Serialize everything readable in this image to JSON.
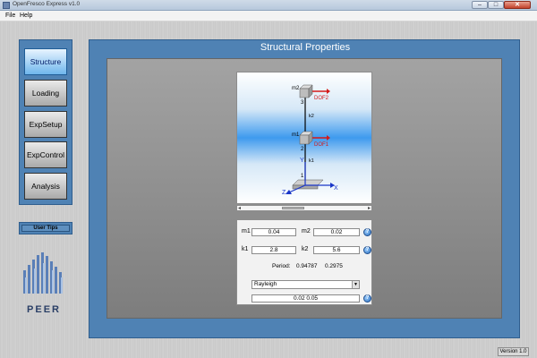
{
  "window": {
    "title": "OpenFresco Express v1.0",
    "controls": [
      "–",
      "□",
      "✕"
    ]
  },
  "menu": {
    "items": [
      "File",
      "Help"
    ]
  },
  "nav": {
    "buttons": [
      {
        "label": "Structure",
        "active": true
      },
      {
        "label": "Loading",
        "active": false
      },
      {
        "label": "ExpSetup",
        "active": false
      },
      {
        "label": "ExpControl",
        "active": false
      },
      {
        "label": "Analysis",
        "active": false
      }
    ],
    "user_tips": "User Tips"
  },
  "logo": {
    "text": "PEER",
    "icon": "peer-logo-icon"
  },
  "main": {
    "title": "Structural Properties",
    "diagram": {
      "labels": {
        "m1": "m1",
        "m2": "m2",
        "k1": "k1",
        "k2": "k2",
        "dof1": "DOF1",
        "dof2": "DOF2",
        "node1": "1",
        "node2": "2",
        "node3": "3",
        "axis_x": "X",
        "axis_y": "Y",
        "axis_z": "Z"
      }
    },
    "props": {
      "m1_label": "m1",
      "m1_value": "0.04",
      "m2_label": "m2",
      "m2_value": "0.02",
      "k1_label": "k1",
      "k1_value": "2.8",
      "k2_label": "k2",
      "k2_value": "5.6",
      "period_label": "Period:",
      "period_values": [
        "0.94787",
        "0.2975"
      ],
      "damping_type": "Rayleigh",
      "damping_value": "0.02 0.05",
      "help_symbol": "?"
    }
  },
  "status": {
    "version": "Version 1.0"
  },
  "colors": {
    "frame_blue": "#4f82b4",
    "dof_red": "#d41a1a",
    "axis_blue": "#1a36c8"
  }
}
